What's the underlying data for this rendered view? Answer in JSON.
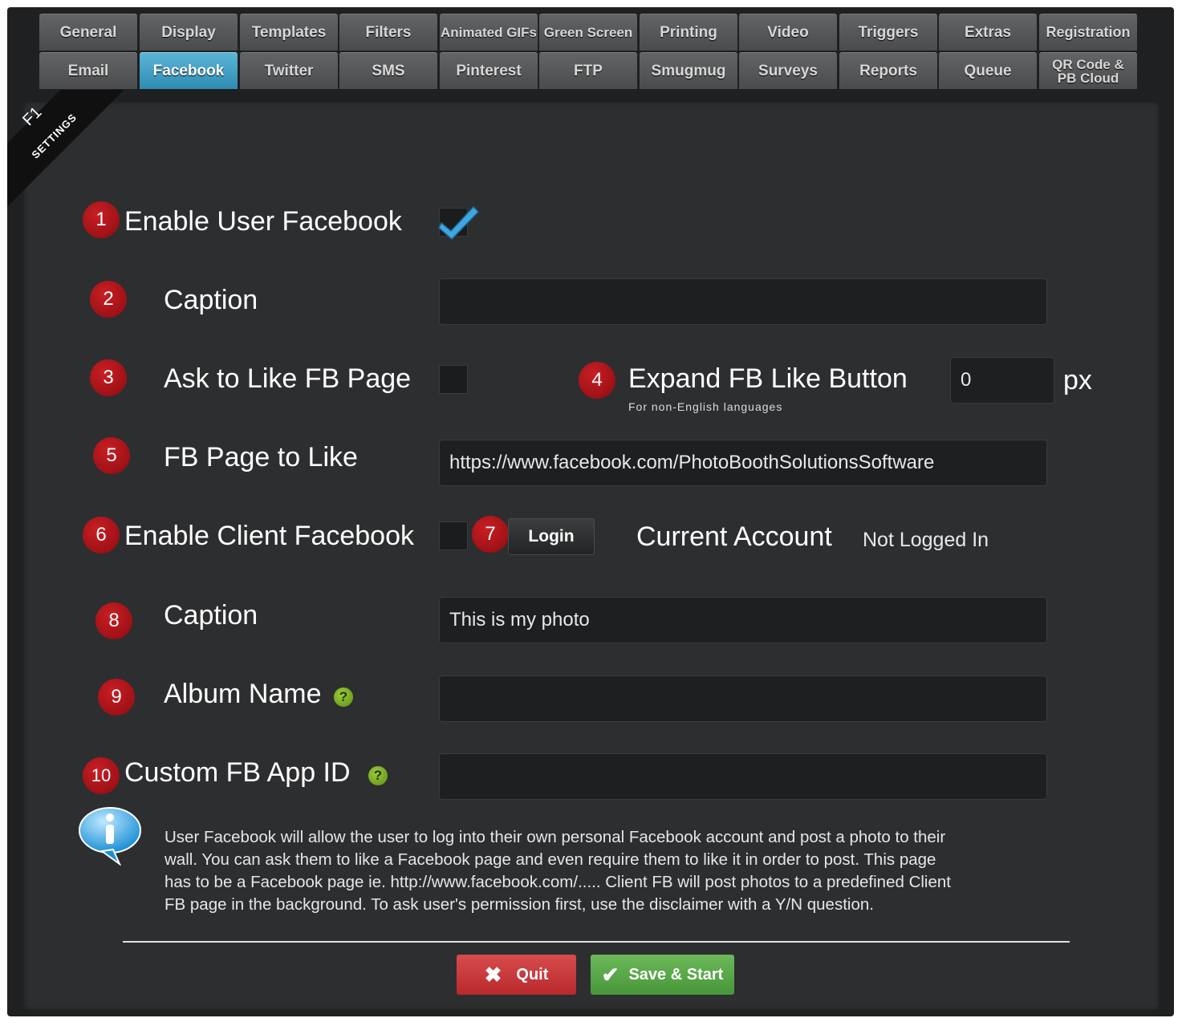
{
  "tabs": {
    "row1": [
      "General",
      "Display",
      "Templates",
      "Filters",
      "Animated GIFs",
      "Green Screen",
      "Printing",
      "Video",
      "Triggers",
      "Extras",
      "Registration"
    ],
    "row2": [
      "Email",
      "Facebook",
      "Twitter",
      "SMS",
      "Pinterest",
      "FTP",
      "Smugmug",
      "Surveys",
      "Reports",
      "Queue",
      "QR Code & PB Cloud"
    ],
    "active": "Facebook"
  },
  "ribbon": {
    "key": "F1",
    "label": "SETTINGS"
  },
  "form": {
    "enable_user_facebook": {
      "num": "1",
      "label": "Enable User Facebook",
      "checked": true
    },
    "caption": {
      "num": "2",
      "label": "Caption",
      "value": ""
    },
    "ask_to_like": {
      "num": "3",
      "label": "Ask to Like FB Page",
      "checked": false
    },
    "expand_like": {
      "num": "4",
      "label": "Expand  FB Like Button",
      "sublabel": "For non-English languages",
      "value": "0",
      "unit": "px"
    },
    "fb_page": {
      "num": "5",
      "label": "FB Page to Like",
      "value": "https://www.facebook.com/PhotoBoothSolutionsSoftware"
    },
    "enable_client_facebook": {
      "num": "6",
      "label": "Enable Client Facebook",
      "checked": false
    },
    "login": {
      "num": "7",
      "label": "Login"
    },
    "current_account": {
      "label": "Current  Account",
      "value": "Not Logged In"
    },
    "client_caption": {
      "num": "8",
      "label": "Caption",
      "value": "This is my photo"
    },
    "album_name": {
      "num": "9",
      "label": "Album Name",
      "value": ""
    },
    "custom_app_id": {
      "num": "10",
      "label": "Custom FB App ID",
      "value": ""
    }
  },
  "info": {
    "line1": "User Facebook will allow the user to log into their own personal Facebook account and post a photo to their",
    "line2": "wall.  You can ask them to like a Facebook page and even require them to like it in order to post.  This page",
    "line3": "has to be a Facebook page ie.  http://www.facebook.com/..... Client FB will post photos to a predefined Client",
    "line4": "FB page in the background.  To ask user's permission first, use the disclaimer with a Y/N question."
  },
  "buttons": {
    "quit": "Quit",
    "save": "Save & Start"
  },
  "colors": {
    "active_tab": "#3fa3cd",
    "badge": "#b3141a",
    "quit": "#c9393b",
    "save": "#58a84a",
    "help": "#7fb12a"
  }
}
